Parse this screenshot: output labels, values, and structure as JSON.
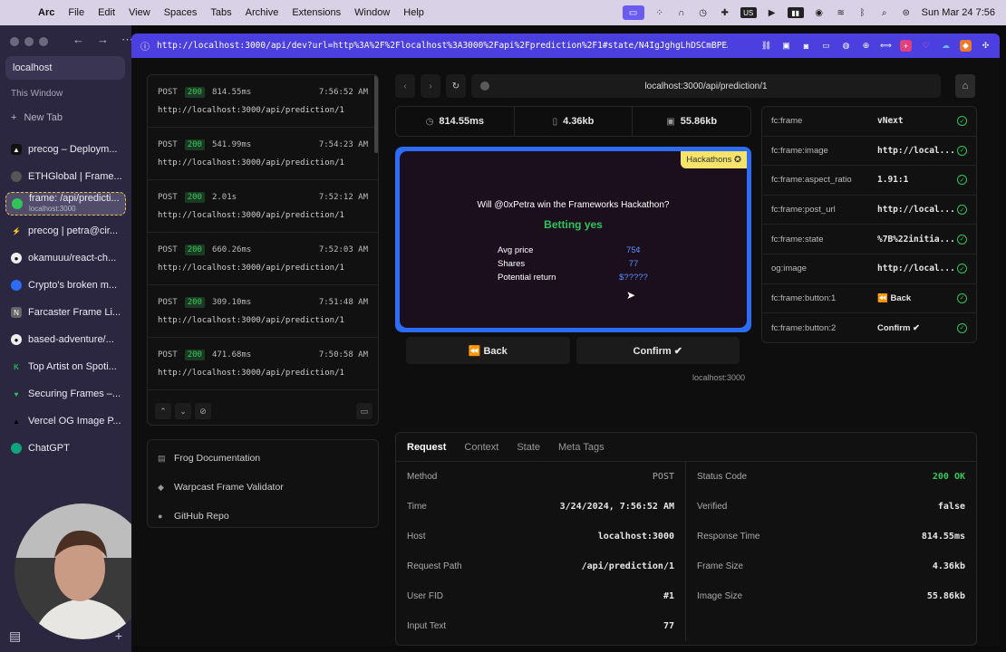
{
  "menubar": {
    "menus": [
      "Arc",
      "File",
      "Edit",
      "View",
      "Spaces",
      "Tabs",
      "Archive",
      "Extensions",
      "Window",
      "Help"
    ],
    "clock": "Sun Mar 24  7:56"
  },
  "sidebar": {
    "url_pill": "localhost",
    "section": "This Window",
    "new_tab": "New Tab",
    "tabs": [
      {
        "label": "precog – Deploym...",
        "color": "#111"
      },
      {
        "label": "ETHGlobal | Frame...",
        "color": "#444"
      },
      {
        "label": "frame: /api/predicti...",
        "sub": "localhost:3000",
        "color": "#2fc45a",
        "active": true
      },
      {
        "label": "precog | petra@cir...",
        "color": "#2fc45a"
      },
      {
        "label": "okamuuu/react-ch...",
        "color": "#222"
      },
      {
        "label": "Crypto's broken m...",
        "color": "#2c6cf6"
      },
      {
        "label": "Farcaster Frame Li...",
        "color": "#555"
      },
      {
        "label": "based-adventure/...",
        "color": "#222"
      },
      {
        "label": "Top Artist on Spoti...",
        "color": "#1db954"
      },
      {
        "label": "Securing Frames –...",
        "color": "#2fc45a"
      },
      {
        "label": "Vercel OG Image P...",
        "color": "#000"
      },
      {
        "label": "ChatGPT",
        "color": "#10a37f"
      }
    ]
  },
  "browser": {
    "url": "http://localhost:3000/api/dev?url=http%3A%2F%2Flocalhost%3A3000%2Fapi%2Fprediction%2F1#state/N4IgJghgLhDSCmBPEAuE8BMAWAzAYwwEYBo2Qi"
  },
  "requests": [
    {
      "method": "POST",
      "status": "200",
      "duration": "814.55ms",
      "time": "7:56:52 AM",
      "url": "http://localhost:3000/api/prediction/1"
    },
    {
      "method": "POST",
      "status": "200",
      "duration": "541.99ms",
      "time": "7:54:23 AM",
      "url": "http://localhost:3000/api/prediction/1"
    },
    {
      "method": "POST",
      "status": "200",
      "duration": "2.01s",
      "time": "7:52:12 AM",
      "url": "http://localhost:3000/api/prediction/1"
    },
    {
      "method": "POST",
      "status": "200",
      "duration": "660.26ms",
      "time": "7:52:03 AM",
      "url": "http://localhost:3000/api/prediction/1"
    },
    {
      "method": "POST",
      "status": "200",
      "duration": "309.10ms",
      "time": "7:51:48 AM",
      "url": "http://localhost:3000/api/prediction/1"
    },
    {
      "method": "POST",
      "status": "200",
      "duration": "471.68ms",
      "time": "7:50:58 AM",
      "url": "http://localhost:3000/api/prediction/1"
    }
  ],
  "links": [
    "Frog Documentation",
    "Warpcast Frame Validator",
    "GitHub Repo"
  ],
  "preview": {
    "address": "localhost:3000/api/prediction/1",
    "stats": {
      "time": "814.55ms",
      "size": "4.36kb",
      "image": "55.86kb"
    },
    "frame": {
      "badge": "Hackathons",
      "question": "Will @0xPetra win the Frameworks Hackathon?",
      "headline": "Betting yes",
      "rows": [
        {
          "label": "Avg price",
          "value": "75¢"
        },
        {
          "label": "Shares",
          "value": "77"
        },
        {
          "label": "Potential return",
          "value": "$?????"
        }
      ]
    },
    "buttons": [
      "⏪ Back",
      "Confirm ✔"
    ],
    "host": "localhost:3000"
  },
  "meta_tags": [
    {
      "key": "fc:frame",
      "value": "vNext"
    },
    {
      "key": "fc:frame:image",
      "value": "http://local..."
    },
    {
      "key": "fc:frame:aspect_ratio",
      "value": "1.91:1"
    },
    {
      "key": "fc:frame:post_url",
      "value": "http://local..."
    },
    {
      "key": "fc:frame:state",
      "value": "%7B%22initia..."
    },
    {
      "key": "og:image",
      "value": "http://local..."
    },
    {
      "key": "fc:frame:button:1",
      "value": "⏪ Back"
    },
    {
      "key": "fc:frame:button:2",
      "value": "Confirm ✔"
    }
  ],
  "details": {
    "tabs": [
      "Request",
      "Context",
      "State",
      "Meta Tags"
    ],
    "left": [
      {
        "label": "Method",
        "value": "POST"
      },
      {
        "label": "Time",
        "value": "3/24/2024, 7:56:52 AM"
      },
      {
        "label": "Host",
        "value": "localhost:3000"
      },
      {
        "label": "Request Path",
        "value": "/api/prediction/1"
      },
      {
        "label": "User FID",
        "value": "#1"
      },
      {
        "label": "Input Text",
        "value": "77"
      }
    ],
    "right": [
      {
        "label": "Status Code",
        "value": "200  OK"
      },
      {
        "label": "Verified",
        "value": "false"
      },
      {
        "label": "Response Time",
        "value": "814.55ms"
      },
      {
        "label": "Frame Size",
        "value": "4.36kb"
      },
      {
        "label": "Image Size",
        "value": "55.86kb"
      }
    ]
  }
}
